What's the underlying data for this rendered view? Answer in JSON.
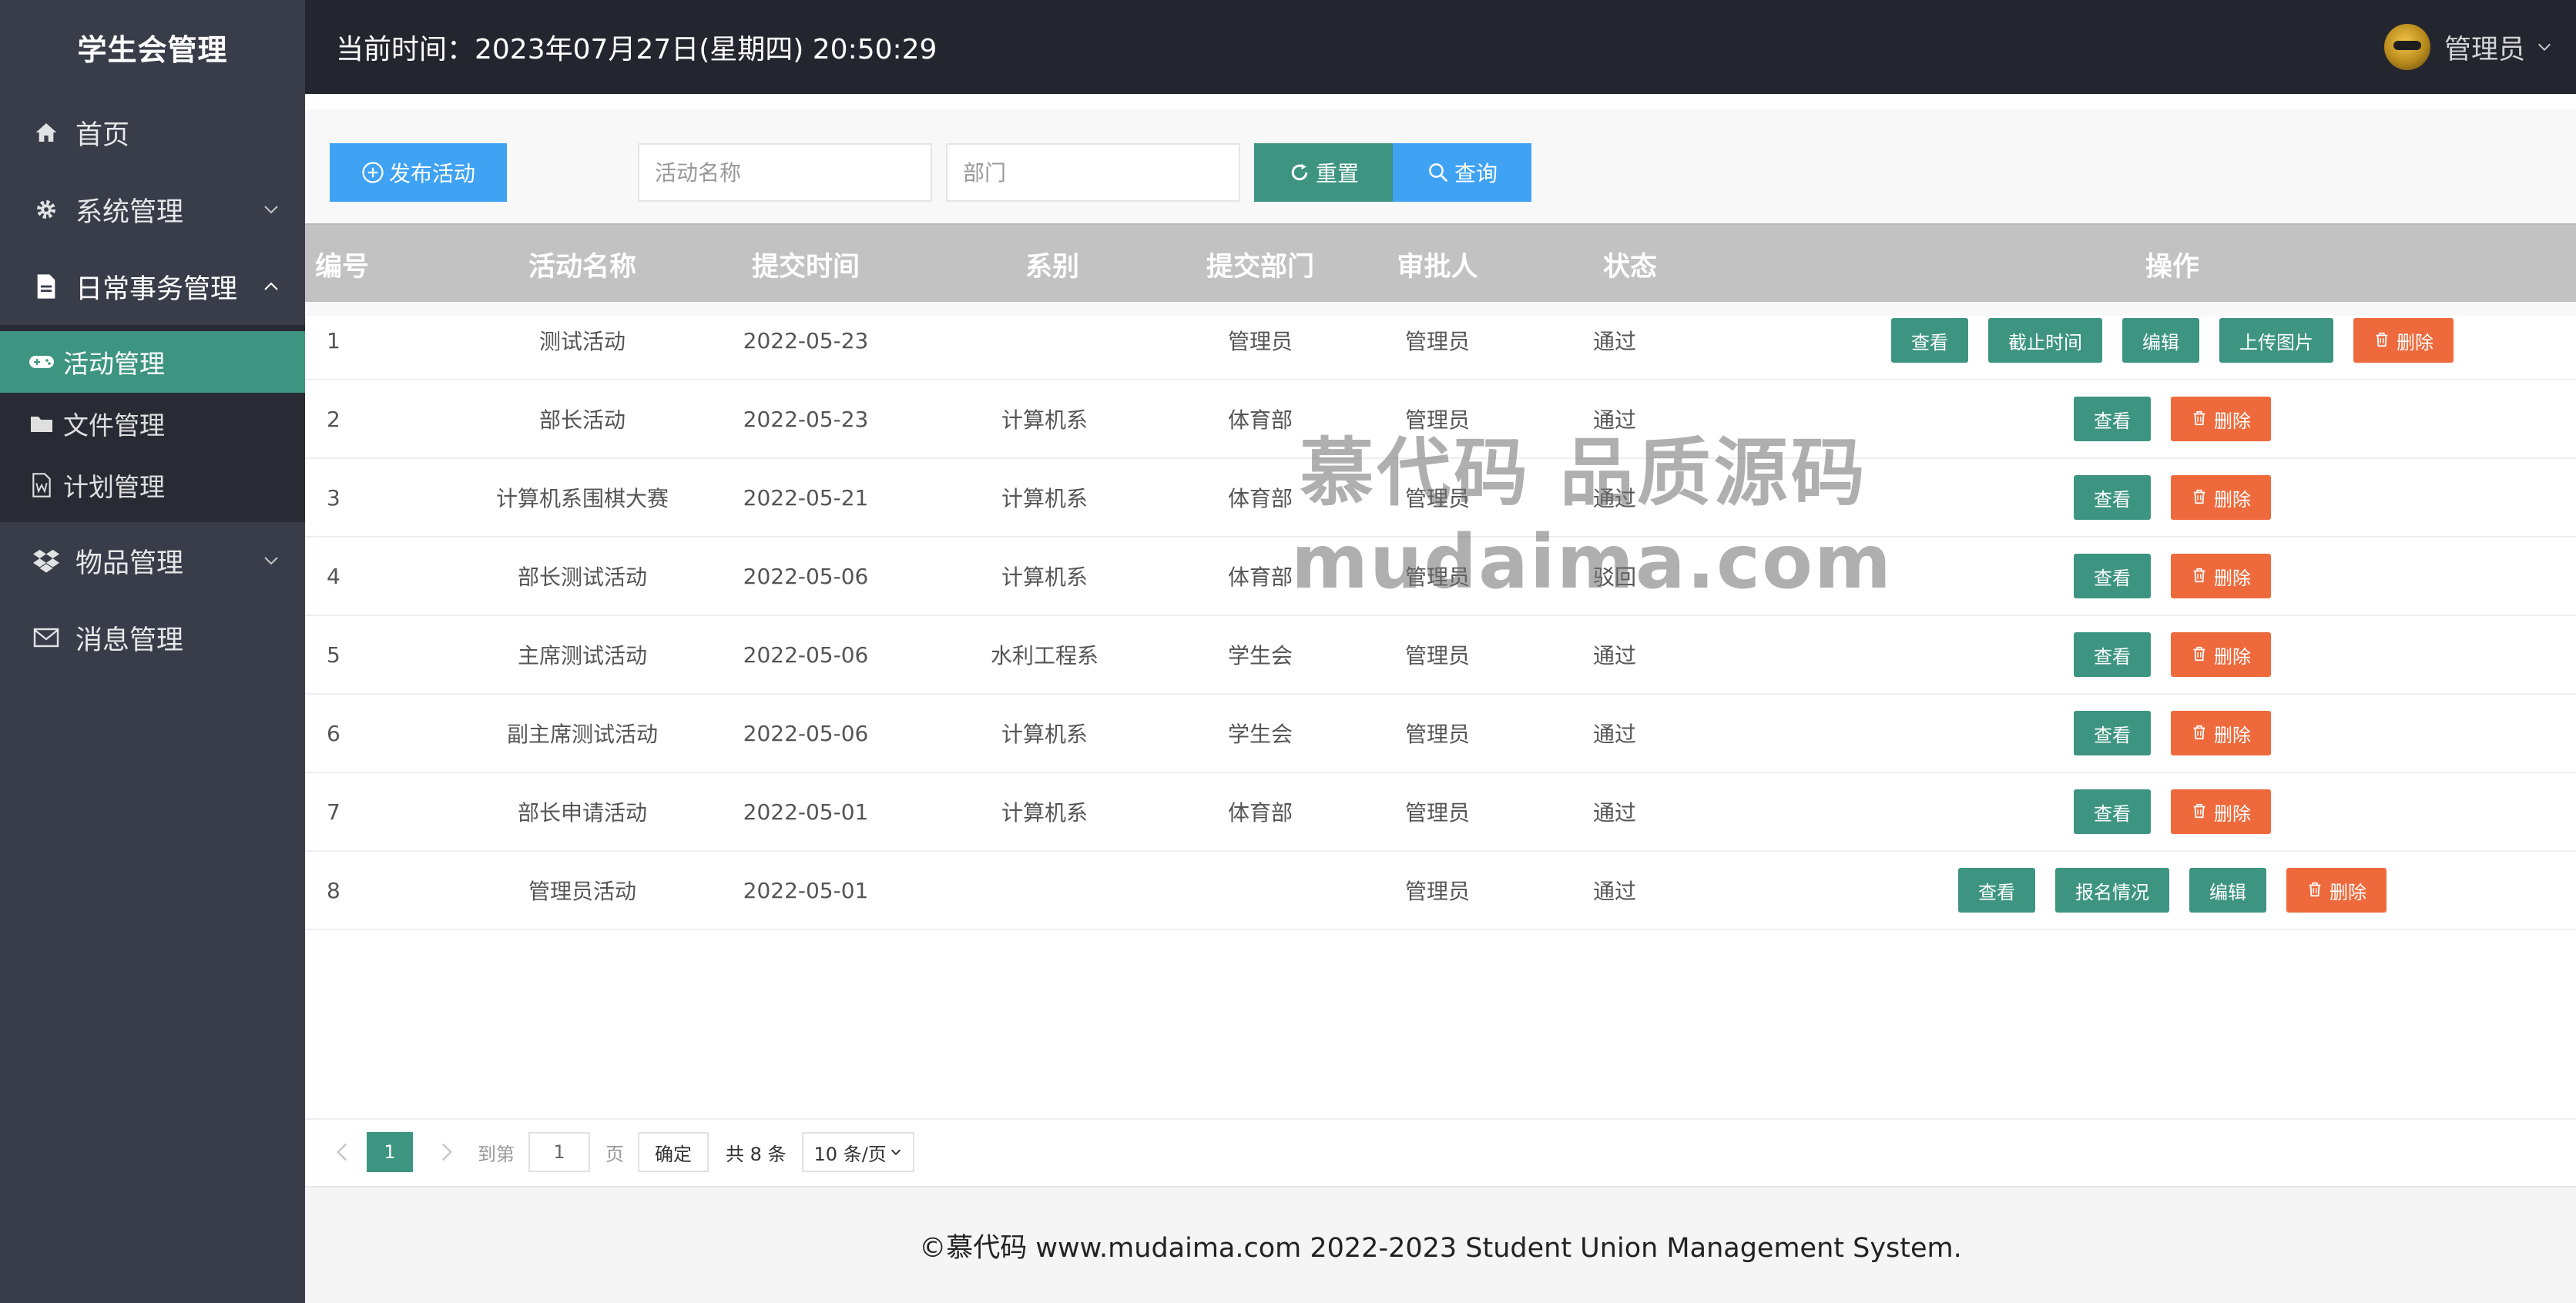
{
  "app": {
    "title": "学生会管理"
  },
  "header": {
    "clock": "当前时间：2023年07月27日(星期四) 20:50:29",
    "user": "管理员"
  },
  "sidebar": {
    "items": [
      {
        "label": "首页",
        "icon": "home-icon"
      },
      {
        "label": "系统管理",
        "icon": "gear-icon"
      },
      {
        "label": "日常事务管理",
        "icon": "file-icon"
      },
      {
        "label": "物品管理",
        "icon": "dropbox-icon"
      },
      {
        "label": "消息管理",
        "icon": "mail-icon"
      }
    ],
    "subitems": [
      {
        "label": "活动管理",
        "icon": "gamepad-icon"
      },
      {
        "label": "文件管理",
        "icon": "folder-icon"
      },
      {
        "label": "计划管理",
        "icon": "word-icon"
      }
    ]
  },
  "toolbar": {
    "publish_label": "发布活动",
    "name_placeholder": "活动名称",
    "dept_placeholder": "部门",
    "reset_label": "重置",
    "query_label": "查询"
  },
  "table": {
    "headers": [
      "编号",
      "活动名称",
      "提交时间",
      "系别",
      "提交部门",
      "审批人",
      "状态",
      "操作"
    ],
    "rows": [
      {
        "id": "1",
        "name": "测试活动",
        "time": "2022-05-23",
        "faculty": "",
        "dept": "管理员",
        "approver": "管理员",
        "status": "通过",
        "ops": [
          "查看",
          "截止时间",
          "编辑",
          "上传图片",
          "删除"
        ]
      },
      {
        "id": "2",
        "name": "部长活动",
        "time": "2022-05-23",
        "faculty": "计算机系",
        "dept": "体育部",
        "approver": "管理员",
        "status": "通过",
        "ops": [
          "查看",
          "删除"
        ]
      },
      {
        "id": "3",
        "name": "计算机系围棋大赛",
        "time": "2022-05-21",
        "faculty": "计算机系",
        "dept": "体育部",
        "approver": "管理员",
        "status": "通过",
        "ops": [
          "查看",
          "删除"
        ]
      },
      {
        "id": "4",
        "name": "部长测试活动",
        "time": "2022-05-06",
        "faculty": "计算机系",
        "dept": "体育部",
        "approver": "管理员",
        "status": "驳回",
        "ops": [
          "查看",
          "删除"
        ]
      },
      {
        "id": "5",
        "name": "主席测试活动",
        "time": "2022-05-06",
        "faculty": "水利工程系",
        "dept": "学生会",
        "approver": "管理员",
        "status": "通过",
        "ops": [
          "查看",
          "删除"
        ]
      },
      {
        "id": "6",
        "name": "副主席测试活动",
        "time": "2022-05-06",
        "faculty": "计算机系",
        "dept": "学生会",
        "approver": "管理员",
        "status": "通过",
        "ops": [
          "查看",
          "删除"
        ]
      },
      {
        "id": "7",
        "name": "部长申请活动",
        "time": "2022-05-01",
        "faculty": "计算机系",
        "dept": "体育部",
        "approver": "管理员",
        "status": "通过",
        "ops": [
          "查看",
          "删除"
        ]
      },
      {
        "id": "8",
        "name": "管理员活动",
        "time": "2022-05-01",
        "faculty": "",
        "dept": "",
        "approver": "管理员",
        "status": "通过",
        "ops": [
          "查看",
          "报名情况",
          "编辑",
          "删除"
        ]
      }
    ]
  },
  "pager": {
    "current": "1",
    "goto_label": "到第",
    "page_input": "1",
    "page_label": "页",
    "confirm_label": "确定",
    "total": "共 8 条",
    "size": "10 条/页"
  },
  "footer": {
    "text": "©慕代码 www.mudaima.com 2022-2023 Student Union Management System."
  },
  "watermark": {
    "line1": "慕代码 品质源码",
    "line2": "mudaima.com"
  },
  "colors": {
    "sidebar": "#393d49",
    "header": "#23262e",
    "accent": "#3d9581",
    "blue": "#3fa2f3",
    "danger": "#ee6a3c"
  }
}
